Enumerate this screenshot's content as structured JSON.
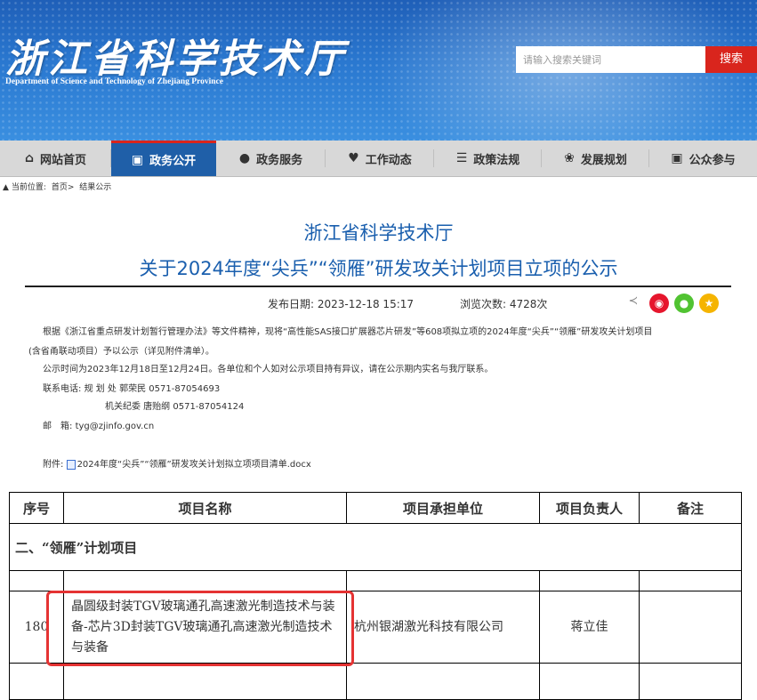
{
  "header": {
    "logo_cn": "浙江省科学技术厅",
    "logo_en": "Department of Science and Technology of Zhejiang Province",
    "search_placeholder": "请输入搜索关键词",
    "search_button": "搜索"
  },
  "nav": {
    "items": [
      {
        "label": "网站首页",
        "icon": "home-icon"
      },
      {
        "label": "政务公开",
        "icon": "gov-open-icon"
      },
      {
        "label": "政务服务",
        "icon": "chat-icon"
      },
      {
        "label": "工作动态",
        "icon": "heart-icon"
      },
      {
        "label": "政策法规",
        "icon": "list-icon"
      },
      {
        "label": "发展规划",
        "icon": "handshake-icon"
      },
      {
        "label": "公众参与",
        "icon": "participate-icon"
      }
    ],
    "active": "政务公开"
  },
  "breadcrumb": {
    "prefix": "当前位置:",
    "home": "首页>",
    "current": "结果公示"
  },
  "article": {
    "site_title": "浙江省科学技术厅",
    "title": "关于2024年度“尖兵”“领雁”研发攻关计划项目立项的公示",
    "publish_label": "发布日期:",
    "publish_date": "2023-12-18 15:17",
    "views_label": "浏览次数:",
    "views": "4728次",
    "para1_line1": "根据《浙江省重点研发计划暂行管理办法》等文件精神，现将“高性能SAS接口扩展器芯片研发”等608项拟立项的2024年度“尖兵”“领雁”研发攻关计划项目",
    "para1_line2": "(含省甬联动项目）予以公示（详见附件清单）。",
    "para2": "公示时间为2023年12月18日至12月24日。各单位和个人如对公示项目持有异议，请在公示期内实名与我厅联系。",
    "contact_label": "联系电话:",
    "contact1": "规 划 处  郭荣民 0571-87054693",
    "contact2": "机关纪委  唐贻纲 0571-87054124",
    "email_label": "邮　箱:",
    "email": "tyg@zjinfo.gov.cn",
    "attach_label": "附件:",
    "attach_file": "2024年度“尖兵”“领雁”研发攻关计划拟立项项目清单.docx"
  },
  "table": {
    "headers": [
      "序号",
      "项目名称",
      "项目承担单位",
      "项目负责人",
      "备注"
    ],
    "section": "二、“领雁”计划项目",
    "row": {
      "no": "180",
      "name": "晶圆级封装TGV玻璃通孔高速激光制造技术与装备-芯片3D封装TGV玻璃通孔高速激光制造技术与装备",
      "unit": "杭州银湖激光科技有限公司",
      "leader": "蒋立佳",
      "note": ""
    }
  },
  "colors": {
    "brand_blue": "#1f5fa8",
    "title_blue": "#1a5fae",
    "search_red": "#d9251d",
    "highlight_red": "#e53333",
    "weibo": "#e6162d",
    "wechat": "#51c332",
    "favorite": "#f5b400"
  },
  "share_icons": [
    "share-icon",
    "weibo-icon",
    "wechat-icon",
    "favorite-icon"
  ]
}
